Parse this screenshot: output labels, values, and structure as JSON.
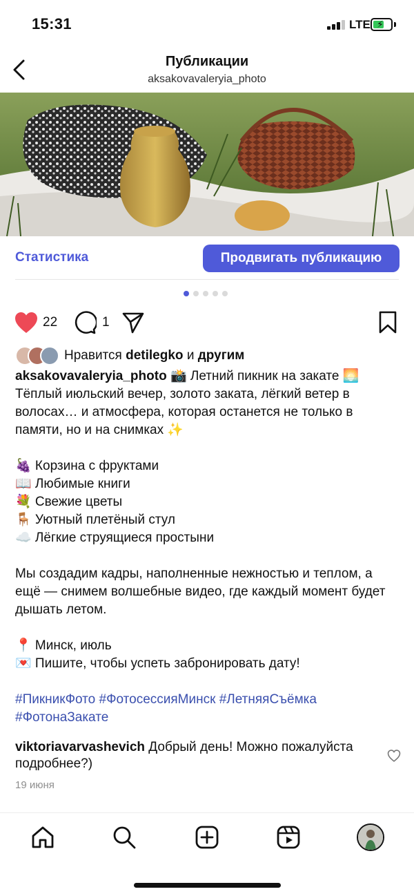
{
  "status": {
    "time": "15:31",
    "network": "LTE"
  },
  "header": {
    "title": "Публикации",
    "subtitle": "aksakovavaleryia_photo"
  },
  "promo": {
    "stats_label": "Статистика",
    "promote_label": "Продвигать публикацию"
  },
  "carousel": {
    "count": 5,
    "active": 0
  },
  "actions": {
    "likes_count": "22",
    "comments_count": "1"
  },
  "likes": {
    "prefix": "Нравится",
    "user": "detilegko",
    "and": "и",
    "others": "другим"
  },
  "caption": {
    "username": "aksakovavaleryia_photo",
    "title": "📸 Летний пикник на закате 🌅",
    "intro": "Тёплый июльский вечер, золото заката, лёгкий ветер в волосах… и атмосфера, которая останется не только в памяти, но и на снимках ✨",
    "list": [
      "🍇 Корзина с фруктами",
      "📖 Любимые книги",
      "💐 Свежие цветы",
      "🪑 Уютный плетёный стул",
      "☁️ Лёгкие струящиеся простыни"
    ],
    "body": "Мы создадим кадры, наполненные нежностью и теплом, а ещё — снимем волшебные видео, где каждый момент будет дышать летом.",
    "location": "📍 Минск, июль",
    "cta": "💌 Пишите, чтобы успеть забронировать дату!",
    "hashtags": "#ПикникФото #ФотосессияМинск #ЛетняяСъёмка #ФотонаЗакате"
  },
  "comment": {
    "user": "viktoriavarvashevich",
    "text": "Добрый день! Можно пожалуйста подробнее?)"
  },
  "date": "19 июня",
  "colors": {
    "accent": "#4f5ad9",
    "like_red": "#ed4956",
    "hashtag": "#3a4fae"
  },
  "icons": [
    "back-icon",
    "heart-icon",
    "comment-icon",
    "share-icon",
    "bookmark-icon",
    "home-icon",
    "search-icon",
    "create-icon",
    "reels-icon",
    "profile-avatar"
  ]
}
